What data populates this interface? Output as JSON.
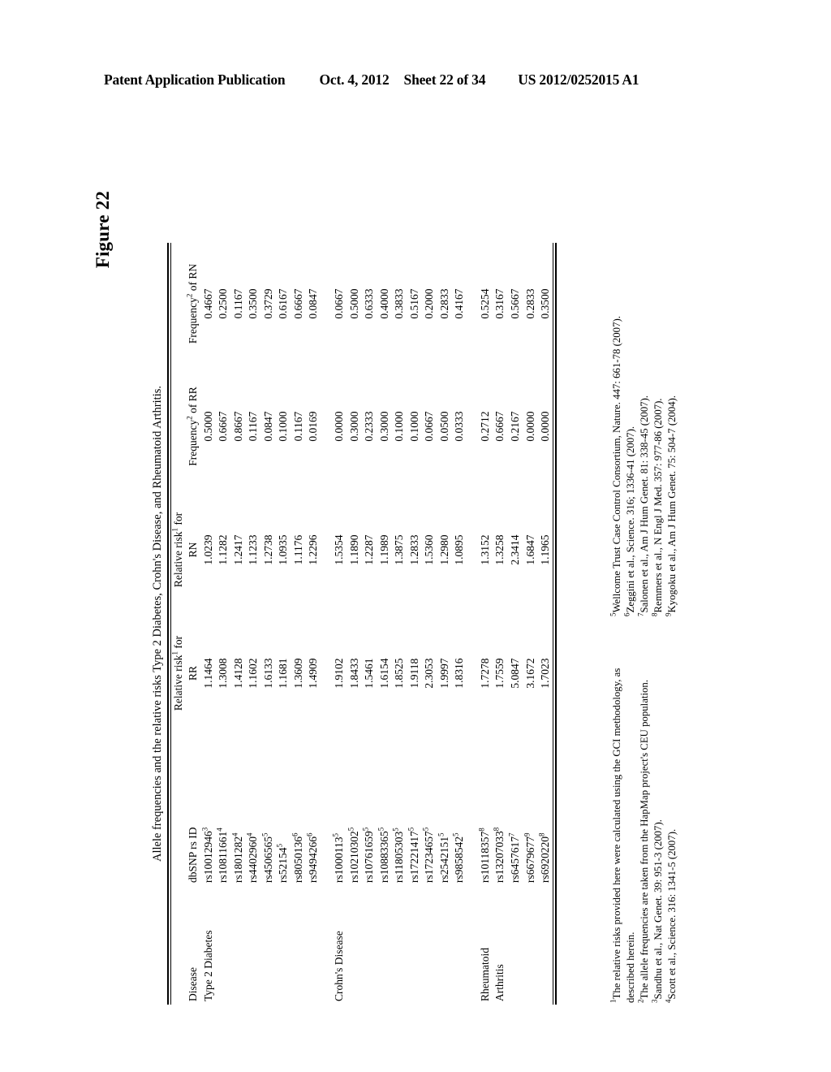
{
  "page_header": {
    "publication": "Patent Application Publication",
    "date": "Oct. 4, 2012",
    "sheet": "Sheet 22 of 34",
    "patent_number": "US 2012/0252015 A1"
  },
  "figure": {
    "label": "Figure 22",
    "table_title": "Allele frequencies and the relative risks Type 2 Diabetes, Crohn's Disease, and Rheumatoid Arthritis."
  },
  "table": {
    "headers": {
      "disease": "Disease",
      "snp": "dbSNP rs ID",
      "rr_line1": "Relative risk",
      "rr_sup": "1",
      "rr_line1_tail": " for",
      "rr_line2": "RR",
      "rn_line1": "Relative risk",
      "rn_sup": "1",
      "rn_line1_tail": " for",
      "rn_line2": "RN",
      "frr_text": "Frequency",
      "frr_sup": "2",
      "frr_tail": " of RR",
      "frn_text": "Frequency",
      "frn_sup": "2",
      "frn_tail": " of RN"
    },
    "groups": [
      {
        "disease": "Type 2 Diabetes",
        "rows": [
          {
            "snp": "rs10012946",
            "snp_sup": "3",
            "rr": "1.1464",
            "rn": "1.0239",
            "f_rr": "0.5000",
            "f_rn": "0.4667"
          },
          {
            "snp": "rs10811661",
            "snp_sup": "4",
            "rr": "1.3008",
            "rn": "1.1282",
            "f_rr": "0.6667",
            "f_rn": "0.2500"
          },
          {
            "snp": "rs1801282",
            "snp_sup": "4",
            "rr": "1.4128",
            "rn": "1.2417",
            "f_rr": "0.8667",
            "f_rn": "0.1167"
          },
          {
            "snp": "rs4402960",
            "snp_sup": "4",
            "rr": "1.1602",
            "rn": "1.1233",
            "f_rr": "0.1167",
            "f_rn": "0.3500"
          },
          {
            "snp": "rs4506565",
            "snp_sup": "5",
            "rr": "1.6133",
            "rn": "1.2738",
            "f_rr": "0.0847",
            "f_rn": "0.3729"
          },
          {
            "snp": "rs52154",
            "snp_sup": "5",
            "rr": "1.1681",
            "rn": "1.0935",
            "f_rr": "0.1000",
            "f_rn": "0.6167"
          },
          {
            "snp": "rs8050136",
            "snp_sup": "6",
            "rr": "1.3609",
            "rn": "1.1176",
            "f_rr": "0.1167",
            "f_rn": "0.6667"
          },
          {
            "snp": "rs9494266",
            "snp_sup": "6",
            "rr": "1.4909",
            "rn": "1.2296",
            "f_rr": "0.0169",
            "f_rn": "0.0847"
          }
        ]
      },
      {
        "disease": "Crohn's Disease",
        "rows": [
          {
            "snp": "rs1000113",
            "snp_sup": "5",
            "rr": "1.9102",
            "rn": "1.5354",
            "f_rr": "0.0000",
            "f_rn": "0.0667"
          },
          {
            "snp": "rs10210302",
            "snp_sup": "5",
            "rr": "1.8433",
            "rn": "1.1890",
            "f_rr": "0.3000",
            "f_rn": "0.5000"
          },
          {
            "snp": "rs10761659",
            "snp_sup": "5",
            "rr": "1.5461",
            "rn": "1.2287",
            "f_rr": "0.2333",
            "f_rn": "0.6333"
          },
          {
            "snp": "rs10883365",
            "snp_sup": "5",
            "rr": "1.6154",
            "rn": "1.1989",
            "f_rr": "0.3000",
            "f_rn": "0.4000"
          },
          {
            "snp": "rs11805303",
            "snp_sup": "5",
            "rr": "1.8525",
            "rn": "1.3875",
            "f_rr": "0.1000",
            "f_rn": "0.3833"
          },
          {
            "snp": "rs17221417",
            "snp_sup": "5",
            "rr": "1.9118",
            "rn": "1.2833",
            "f_rr": "0.1000",
            "f_rn": "0.5167"
          },
          {
            "snp": "rs17234657",
            "snp_sup": "5",
            "rr": "2.3053",
            "rn": "1.5360",
            "f_rr": "0.0667",
            "f_rn": "0.2000"
          },
          {
            "snp": "rs2542151",
            "snp_sup": "5",
            "rr": "1.9997",
            "rn": "1.2980",
            "f_rr": "0.0500",
            "f_rn": "0.2833"
          },
          {
            "snp": "rs9858542",
            "snp_sup": "5",
            "rr": "1.8316",
            "rn": "1.0895",
            "f_rr": "0.0333",
            "f_rn": "0.4167"
          }
        ]
      },
      {
        "disease": "Rheumatoid\nArthritis",
        "disease_line1": "Rheumatoid",
        "disease_line2": "Arthritis",
        "rows": [
          {
            "snp": "rs10118357",
            "snp_sup": "8",
            "rr": "1.7278",
            "rn": "1.3152",
            "f_rr": "0.2712",
            "f_rn": "0.5254"
          },
          {
            "snp": "rs13207033",
            "snp_sup": "8",
            "rr": "1.7559",
            "rn": "1.3258",
            "f_rr": "0.6667",
            "f_rn": "0.3167"
          },
          {
            "snp": "rs6457617",
            "snp_sup": "7",
            "rr": "5.0847",
            "rn": "2.3414",
            "f_rr": "0.2167",
            "f_rn": "0.5667"
          },
          {
            "snp": "rs6679677",
            "snp_sup": "9",
            "rr": "3.1672",
            "rn": "1.6847",
            "f_rr": "0.0000",
            "f_rn": "0.2833"
          },
          {
            "snp": "rs6920220",
            "snp_sup": "8",
            "rr": "1.7023",
            "rn": "1.1965",
            "f_rr": "0.0000",
            "f_rn": "0.3500"
          }
        ]
      }
    ]
  },
  "footnotes": {
    "left": [
      {
        "sup": "1",
        "text": "The relative risks provided here were calculated using the GCI methodology, as described herein."
      },
      {
        "sup": "2",
        "text": "The allele frequencies are taken from the HapMap project's CEU population."
      },
      {
        "sup": "3",
        "text": "Sandhu et al., Nat Genet. 39: 951-3 (2007)."
      },
      {
        "sup": "4",
        "text": "Scott et al., Science. 316: 1341-5 (2007)."
      }
    ],
    "right": [
      {
        "sup": "5",
        "text": "Wellcome Trust Case Control Consortium, Nature. 447: 661-78 (2007)."
      },
      {
        "sup": "6",
        "text": "Zeggini et al., Science. 316; 1336-41 (2007)."
      },
      {
        "sup": "7",
        "text": "Salonen et al., Am J Hum Genet. 81: 338-45 (2007)."
      },
      {
        "sup": "8",
        "text": "Remmers et al., N Engl J Med. 357: 977-86 (2007)."
      },
      {
        "sup": "9",
        "text": "Kyogoku et al., Am J Hum Genet. 75: 504-7 (2004)."
      }
    ]
  }
}
